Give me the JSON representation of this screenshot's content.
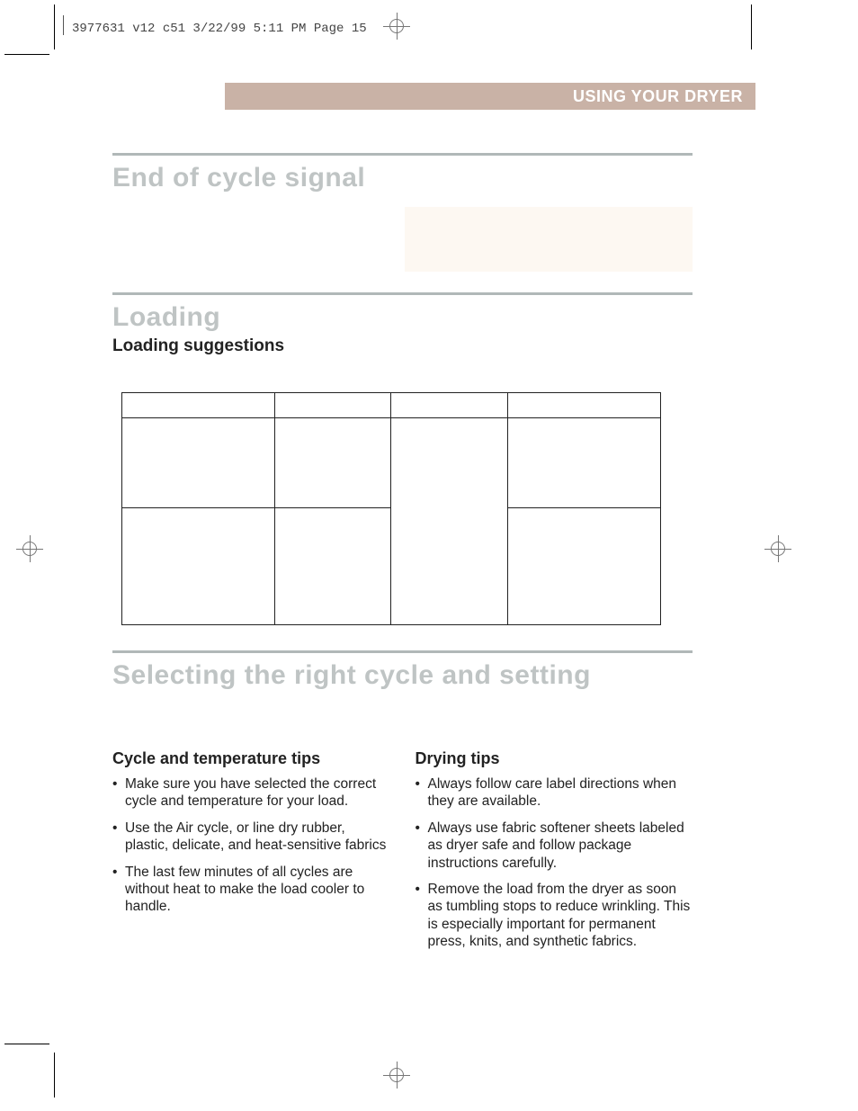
{
  "slug": "3977631 v12 c51  3/22/99 5:11 PM  Page 15",
  "header": "USING YOUR DRYER",
  "sections": {
    "s1": {
      "heading": "End of cycle signal"
    },
    "s2": {
      "heading": "Loading",
      "sub": "Loading suggestions"
    },
    "s3": {
      "heading": "Selecting the right cycle and setting"
    }
  },
  "tips": {
    "cycle": {
      "heading": "Cycle and temperature tips",
      "items": [
        "Make sure you have selected the correct cycle and temperature for your load.",
        "Use the Air cycle, or line dry rubber, plastic, delicate, and heat-sensitive fabrics",
        "The last few minutes of all cycles are without heat to make the load cooler to handle."
      ]
    },
    "drying": {
      "heading": "Drying tips",
      "items": [
        "Always follow care label directions when they are available.",
        "Always use fabric softener sheets labeled as dryer safe and follow package instructions carefully.",
        "Remove the load from the dryer as soon as tumbling stops to reduce wrinkling. This is especially important for permanent press, knits, and synthetic fabrics."
      ]
    }
  }
}
